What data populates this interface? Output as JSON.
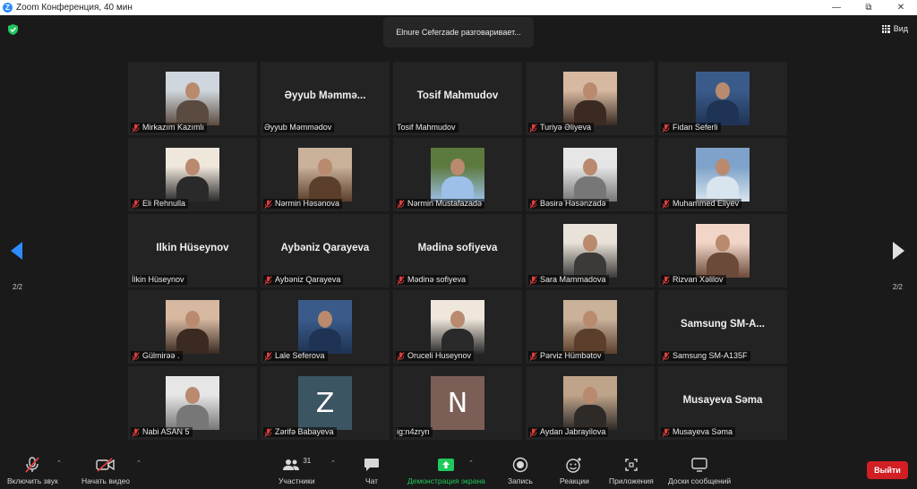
{
  "window": {
    "title": "Zoom Конференция, 40 мин",
    "logo_letter": "Z"
  },
  "stage": {
    "speaking_toast": "Elnure Ceferzade разговаривает...",
    "view_label": "Вид",
    "page_left": "2/2",
    "page_right": "2/2"
  },
  "participants": [
    {
      "label": "Mirkazım Kazımlı",
      "kind": "photo",
      "muted": true
    },
    {
      "label": "Əyyub Məmmədov",
      "kind": "name",
      "big_name": "Əyyub Məmmə...",
      "muted": false
    },
    {
      "label": "Tosif Mahmudov",
      "kind": "name",
      "big_name": "Tosif Mahmudov",
      "muted": false
    },
    {
      "label": "Turiyə Əliyeva",
      "kind": "photo",
      "muted": true
    },
    {
      "label": "Fidan Seferli",
      "kind": "photo",
      "muted": true
    },
    {
      "label": "Eli Rehnulla",
      "kind": "photo",
      "muted": true
    },
    {
      "label": "Nərmin Həsənova",
      "kind": "photo",
      "muted": true
    },
    {
      "label": "Nərmin Mustafazadə",
      "kind": "photo",
      "muted": true
    },
    {
      "label": "Bəsirə Həsənzadə",
      "kind": "photo",
      "muted": true
    },
    {
      "label": "Muhammed Eliyev",
      "kind": "photo",
      "muted": true
    },
    {
      "label": "İlkin Hüseynov",
      "kind": "name",
      "big_name": "İlkin Hüseynov",
      "muted": false
    },
    {
      "label": "Aybəniz Qarayeva",
      "kind": "name",
      "big_name": "Aybəniz Qarayeva",
      "muted": true
    },
    {
      "label": "Mədinə sofiyeva",
      "kind": "name",
      "big_name": "Mədinə sofiyeva",
      "muted": true
    },
    {
      "label": "Sara Mammadova",
      "kind": "photo",
      "muted": true
    },
    {
      "label": "Rizvan Xəlilov",
      "kind": "photo",
      "muted": true
    },
    {
      "label": "Gülmirəə .",
      "kind": "photo",
      "muted": true
    },
    {
      "label": "Lale Seferova",
      "kind": "photo",
      "muted": true
    },
    {
      "label": "Oruceli Huseynov",
      "kind": "photo",
      "muted": true
    },
    {
      "label": "Pərviz Hümbətov",
      "kind": "photo",
      "muted": true
    },
    {
      "label": "Samsung SM-A135F",
      "kind": "name",
      "big_name": "Samsung SM-A...",
      "muted": true
    },
    {
      "label": "Nabi ASAN 5",
      "kind": "photo",
      "muted": true
    },
    {
      "label": "Zərifə Babayeva",
      "kind": "letter",
      "letter": "Z",
      "muted": true
    },
    {
      "label": "ig:n4zryn",
      "kind": "letter",
      "letter": "N",
      "muted": false
    },
    {
      "label": "Aydan Jabrayilova",
      "kind": "photo",
      "muted": true
    },
    {
      "label": "Musayeva Səma",
      "kind": "name",
      "big_name": "Musayeva Səma",
      "muted": true
    }
  ],
  "toolbar": {
    "unmute": "Включить звук",
    "start_video": "Начать видео",
    "participants": "Участники",
    "participants_count": "31",
    "chat": "Чат",
    "share_screen": "Демонстрация экрана",
    "record": "Запись",
    "reactions": "Реакции",
    "apps": "Приложения",
    "whiteboards": "Доски сообщений",
    "leave": "Выйти"
  },
  "colors": {
    "accent": "#2d8cff",
    "share_green": "#1fc95b",
    "leave_red": "#d21f24",
    "mute_red": "#e03e3e",
    "avatar_z": "#3c5563",
    "avatar_n": "#7b5f57"
  }
}
